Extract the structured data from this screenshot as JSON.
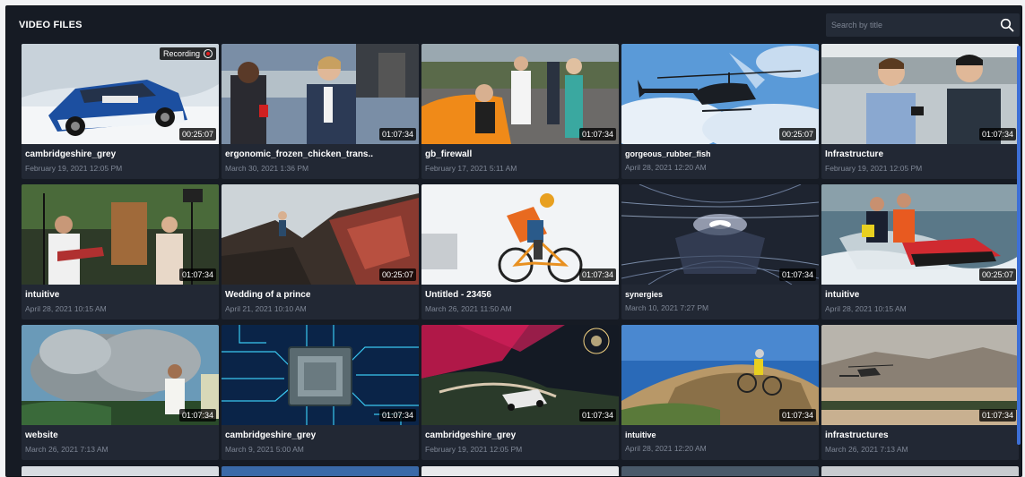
{
  "header": {
    "title": "VIDEO FILES"
  },
  "search": {
    "placeholder": "Search by title",
    "value": ""
  },
  "recording_badge": {
    "label": "Recording"
  },
  "videos": [
    {
      "name": "cambridgeshire_grey",
      "date": "February 19, 2021 12:05 PM",
      "duration": "00:25:07",
      "recording": true,
      "thumb": "rally-car"
    },
    {
      "name": "ergonomic_frozen_chicken_trans..",
      "date": "March 30, 2021 1:36 PM",
      "duration": "01:07:34",
      "thumb": "interview-racetrack"
    },
    {
      "name": "gb_firewall",
      "date": "February 17, 2021 5:11 AM",
      "duration": "01:07:34",
      "thumb": "pitlane-crowd"
    },
    {
      "name": "gorgeous_rubber_fish",
      "date": "April 28, 2021 12:20 AM",
      "duration": "00:25:07",
      "thumb": "helicopter-sky"
    },
    {
      "name": "Infrastructure",
      "date": "February 19, 2021 12:05 PM",
      "duration": "01:07:34",
      "thumb": "street-interview"
    },
    {
      "name": "intuitive",
      "date": "April 28, 2021 10:15 AM",
      "duration": "01:07:34",
      "thumb": "musicians"
    },
    {
      "name": "Wedding of a prince",
      "date": "April 21, 2021 10:10 AM",
      "duration": "00:25:07",
      "thumb": "rock-climb"
    },
    {
      "name": "Untitled - 23456",
      "date": "March 26, 2021 11:50 AM",
      "duration": "01:07:34",
      "thumb": "cyclist"
    },
    {
      "name": "synergies",
      "date": "March 10, 2021 7:27 PM",
      "duration": "01:07:34",
      "thumb": "data-tunnel"
    },
    {
      "name": "intuitive",
      "date": "April 28, 2021 10:15 AM",
      "duration": "00:25:07",
      "thumb": "jetski"
    },
    {
      "name": "website",
      "date": "March 26, 2021 7:13 AM",
      "duration": "01:07:34",
      "thumb": "volcano"
    },
    {
      "name": "cambridgeshire_grey",
      "date": "March 9, 2021 5:00 AM",
      "duration": "01:07:34",
      "thumb": "circuit-chip"
    },
    {
      "name": "cambridgeshire_grey",
      "date": "February 19, 2021 12:05 PM",
      "duration": "01:07:34",
      "thumb": "night-rally"
    },
    {
      "name": "intuitive",
      "date": "April 28, 2021 12:20 AM",
      "duration": "01:07:34",
      "thumb": "mountain-bike"
    },
    {
      "name": "infrastructures",
      "date": "March 26, 2021 7:13 AM",
      "duration": "01:07:34",
      "thumb": "helicopter-field"
    }
  ],
  "colors": {
    "panel": "#161b24",
    "card": "#222834",
    "accent": "#3d6fd6"
  }
}
